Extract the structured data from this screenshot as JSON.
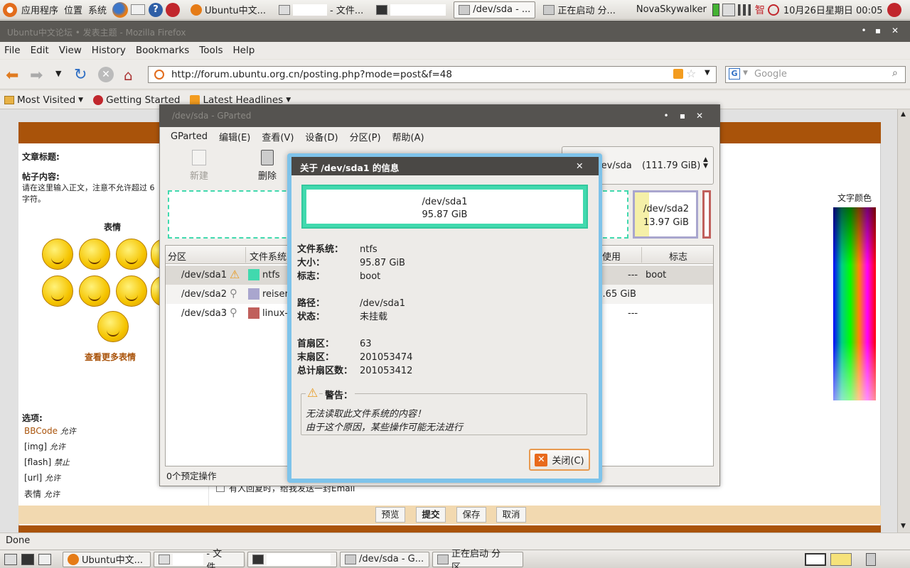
{
  "top_panel": {
    "applications": "应用程序",
    "places": "位置",
    "system": "系统",
    "tasks": [
      {
        "label": "Ubuntu中文...",
        "active": false
      },
      {
        "label": "- 文件...",
        "active": false
      },
      {
        "label": "",
        "active": false
      },
      {
        "label": "/dev/sda - ...",
        "active": true
      },
      {
        "label": "正在启动 分...",
        "active": false
      }
    ],
    "user": "NovaSkywalker",
    "datetime": "10月26日星期日 00:05"
  },
  "firefox": {
    "title": "Ubuntu中文论坛 • 发表主题 - Mozilla Firefox",
    "menu": [
      "File",
      "Edit",
      "View",
      "History",
      "Bookmarks",
      "Tools",
      "Help"
    ],
    "url": "http://forum.ubuntu.org.cn/posting.php?mode=post&f=48",
    "search_placeholder": "Google",
    "bookmarks": [
      "Most Visited",
      "Getting Started",
      "Latest Headlines"
    ],
    "status": "Done"
  },
  "forum": {
    "subject_label": "文章标题:",
    "content_label": "帖子内容:",
    "content_hint": "请在这里输入正文，注意不允许超过 6",
    "content_hint2": "字符。",
    "smilies_title": "表情",
    "more_smilies": "查看更多表情",
    "color_label": "文字颜色",
    "options_label": "选项:",
    "options": [
      {
        "name": "BBCode",
        "state": "允许"
      },
      {
        "name": "[img]",
        "state": "允许"
      },
      {
        "name": "[flash]",
        "state": "禁止"
      },
      {
        "name": "[url]",
        "state": "允许"
      },
      {
        "name": "表情",
        "state": "允许"
      }
    ],
    "notify_label": "有人回复时，给我发送一封Email",
    "buttons": [
      "预览",
      "提交",
      "保存",
      "取消"
    ]
  },
  "gparted": {
    "title": "/dev/sda - GParted",
    "menu": [
      "GParted",
      "编辑(E)",
      "查看(V)",
      "设备(D)",
      "分区(P)",
      "帮助(A)"
    ],
    "toolbar": {
      "new": "新建",
      "delete": "删除"
    },
    "device": "/dev/sda",
    "device_size": "(111.79 GiB)",
    "graph_sda2_name": "/dev/sda2",
    "graph_sda2_size": "13.97 GiB",
    "columns": {
      "partition": "分区",
      "filesystem": "文件系统",
      "used": "使用",
      "flags": "标志"
    },
    "rows": [
      {
        "partition": "/dev/sda1",
        "fs": "ntfs",
        "fs_color": "#41d9ae",
        "used": "---",
        "flags": "boot"
      },
      {
        "partition": "/dev/sda2",
        "fs": "reiserfs",
        "fs_color": "#a9a6ce",
        "used": "10.65 GiB",
        "flags": ""
      },
      {
        "partition": "/dev/sda3",
        "fs": "linux-swap",
        "fs_color": "#c0605c",
        "used": "---",
        "flags": ""
      }
    ],
    "status": "0个预定操作"
  },
  "dialog": {
    "title": "关于 /dev/sda1 的信息",
    "part_name": "/dev/sda1",
    "part_size": "95.87 GiB",
    "filesystem_label": "文件系统：",
    "filesystem": "ntfs",
    "size_label": "大小：",
    "size": "95.87 GiB",
    "flags_label": "标志：",
    "flags": "boot",
    "path_label": "路径：",
    "path": "/dev/sda1",
    "status_label": "状态：",
    "status": "未挂载",
    "first_sector_label": "首扇区：",
    "first_sector": "63",
    "last_sector_label": "末扇区：",
    "last_sector": "201053474",
    "total_sectors_label": "总计扇区数：",
    "total_sectors": "201053412",
    "warning_title": "警告：",
    "warning_line1": "无法读取此文件系统的内容！",
    "warning_line2": "由于这个原因，某些操作可能无法进行",
    "close_label": "关闭(C)"
  },
  "bottom_panel": {
    "tasks": [
      {
        "label": "Ubuntu中文..."
      },
      {
        "label": "- 文件..."
      },
      {
        "label": ""
      },
      {
        "label": "/dev/sda - G..."
      },
      {
        "label": "正在启动 分区..."
      }
    ]
  },
  "colors": {
    "accent": "#a9530a",
    "ntfs": "#41d9ae",
    "dialog_border": "#7ec3ea",
    "close_border": "#e89a50"
  }
}
